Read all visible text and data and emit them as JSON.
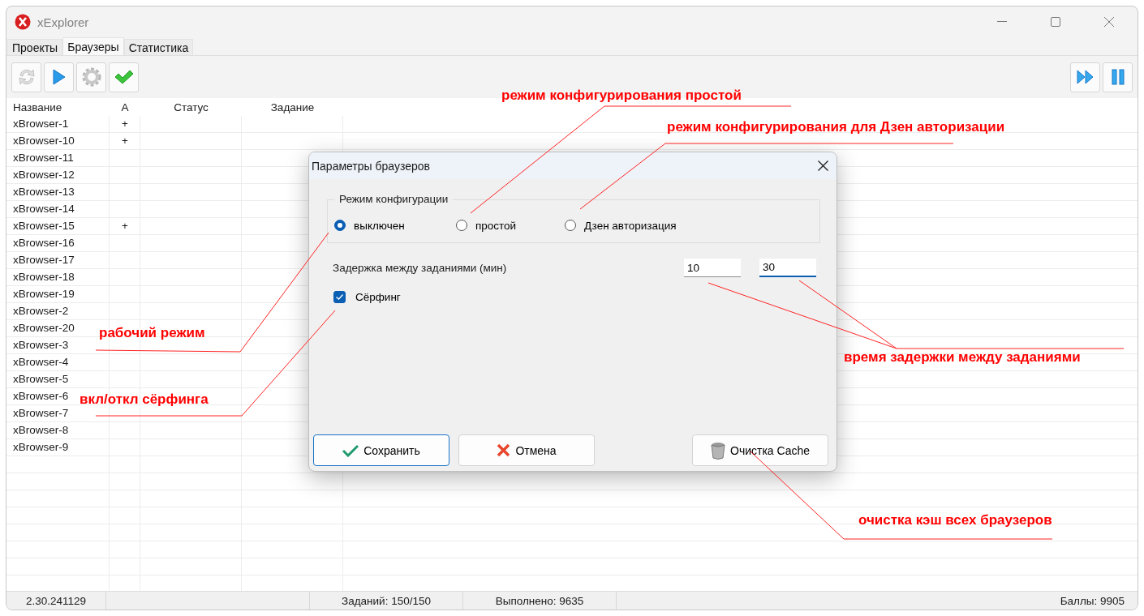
{
  "window": {
    "title": "xExplorer"
  },
  "tabs": [
    {
      "label": "Проекты",
      "selected": false
    },
    {
      "label": "Браузеры",
      "selected": true
    },
    {
      "label": "Статистика",
      "selected": false
    }
  ],
  "toolbar": {
    "left": [
      {
        "kind": "refresh",
        "disabled": true
      },
      {
        "kind": "play",
        "disabled": false
      },
      {
        "kind": "gear",
        "disabled": true
      },
      {
        "kind": "check",
        "disabled": false
      }
    ],
    "right": [
      {
        "kind": "fast-forward",
        "disabled": false
      },
      {
        "kind": "pause",
        "disabled": false
      }
    ]
  },
  "table": {
    "columns": [
      "Название",
      "А",
      "Статус",
      "Задание"
    ],
    "rows": [
      {
        "name": "xBrowser-1",
        "a": "+"
      },
      {
        "name": "xBrowser-10",
        "a": "+"
      },
      {
        "name": "xBrowser-11"
      },
      {
        "name": "xBrowser-12"
      },
      {
        "name": "xBrowser-13"
      },
      {
        "name": "xBrowser-14"
      },
      {
        "name": "xBrowser-15",
        "a": "+"
      },
      {
        "name": "xBrowser-16"
      },
      {
        "name": "xBrowser-17"
      },
      {
        "name": "xBrowser-18"
      },
      {
        "name": "xBrowser-19"
      },
      {
        "name": "xBrowser-2"
      },
      {
        "name": "xBrowser-20"
      },
      {
        "name": "xBrowser-3"
      },
      {
        "name": "xBrowser-4"
      },
      {
        "name": "xBrowser-5"
      },
      {
        "name": "xBrowser-6"
      },
      {
        "name": "xBrowser-7"
      },
      {
        "name": "xBrowser-8"
      },
      {
        "name": "xBrowser-9"
      }
    ]
  },
  "status_bar": [
    "2.30.241129",
    "Заданий: 150/150",
    "Выполнено: 9635",
    "Баллы: 9905"
  ],
  "dialog": {
    "title": "Параметры браузеров",
    "group": {
      "title": "Режим конфигурации",
      "options": [
        {
          "label": "выключен",
          "selected": true
        },
        {
          "label": "простой",
          "selected": false
        },
        {
          "label": "Дзен авторизация",
          "selected": false
        }
      ]
    },
    "delay": {
      "label": "Задержка между заданиями (мин)",
      "fields": [
        {
          "value": "10",
          "focused": false
        },
        {
          "value": "30",
          "focused": true
        }
      ]
    },
    "surfing": {
      "label": "Сёрфинг",
      "checked": true
    },
    "buttons": [
      {
        "kind": "save",
        "label": "Сохранить",
        "default": true
      },
      {
        "kind": "cancel",
        "label": "Отмена",
        "default": false
      },
      {
        "kind": "cache",
        "label": "Очистка Cache",
        "default": false
      }
    ]
  },
  "annotations": [
    {
      "text": "режим конфигурирования простой"
    },
    {
      "text": "режим конфигурирования для Дзен авторизации"
    },
    {
      "text": "рабочий режим"
    },
    {
      "text": "вкл/откл сёрфинга"
    },
    {
      "text": "время задержки между заданиями"
    },
    {
      "text": "очистка кэш всех браузеров"
    }
  ]
}
